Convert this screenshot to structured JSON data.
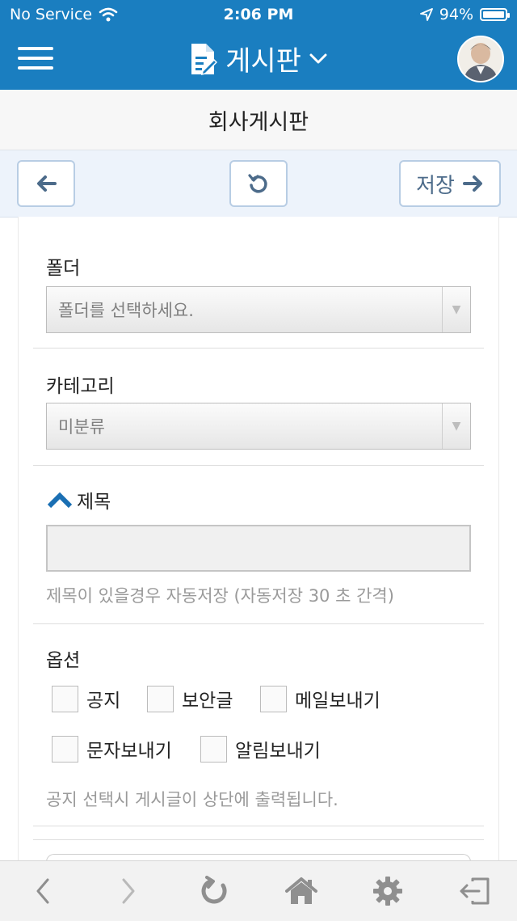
{
  "status": {
    "carrier": "No Service",
    "time": "2:06 PM",
    "battery": "94%"
  },
  "header": {
    "title": "게시판",
    "subtitle": "회사게시판"
  },
  "toolbar": {
    "save_label": "저장"
  },
  "form": {
    "folder": {
      "label": "폴더",
      "value": "폴더를 선택하세요."
    },
    "category": {
      "label": "카테고리",
      "value": "미분류"
    },
    "subject": {
      "label": "제목",
      "value": "",
      "hint": "제목이 있을경우 자동저장 (자동저장 30 초 간격)"
    },
    "options": {
      "label": "옵션",
      "items": [
        {
          "label": "공지",
          "checked": false
        },
        {
          "label": "보안글",
          "checked": false
        },
        {
          "label": "메일보내기",
          "checked": false
        },
        {
          "label": "문자보내기",
          "checked": false
        },
        {
          "label": "알림보내기",
          "checked": false
        }
      ],
      "hint": "공지 선택시 게시글이 상단에 출력됩니다."
    }
  },
  "colors": {
    "brand": "#1a7ec0",
    "toolbar_bg": "#edf3fb",
    "button_border": "#b8cde4",
    "icon": "#4c6b8a"
  },
  "icons": {
    "bottom_nav": [
      "back-icon",
      "forward-icon",
      "refresh-icon",
      "home-icon",
      "settings-icon",
      "logout-icon"
    ]
  }
}
